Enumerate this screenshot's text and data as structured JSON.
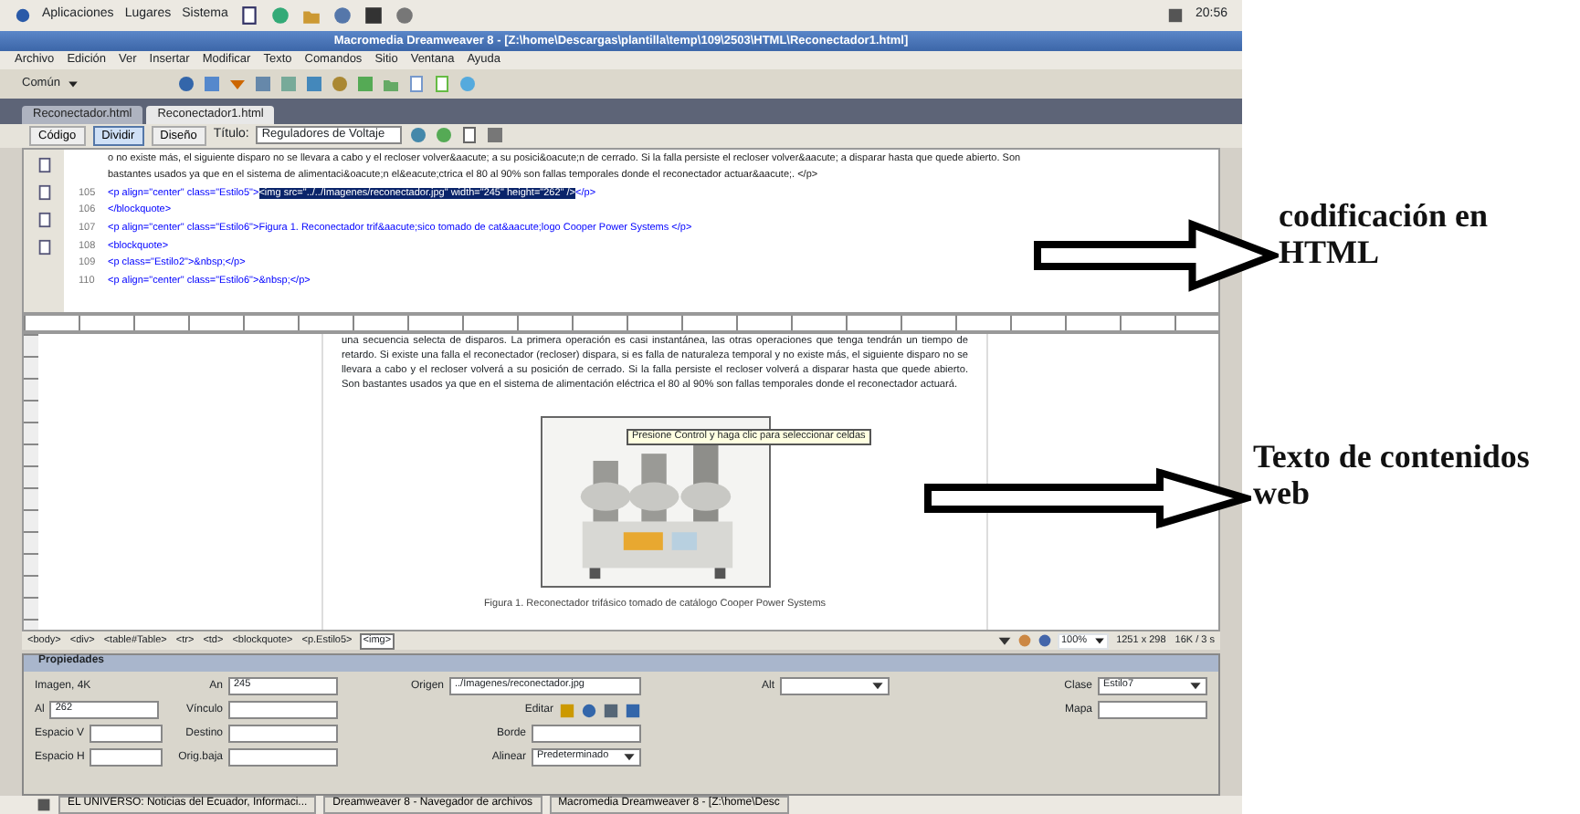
{
  "top_panel": {
    "menus": [
      "Aplicaciones",
      "Lugares",
      "Sistema"
    ],
    "clock": "20:56"
  },
  "window": {
    "title": "Macromedia Dreamweaver 8 - [Z:\\home\\Descargas\\plantilla\\temp\\109\\2503\\HTML\\Reconectador1.html]"
  },
  "menu": [
    "Archivo",
    "Edición",
    "Ver",
    "Insertar",
    "Modificar",
    "Texto",
    "Comandos",
    "Sitio",
    "Ventana",
    "Ayuda"
  ],
  "insert_bar": {
    "category": "Común"
  },
  "doc_tabs": [
    {
      "label": "Reconectador.html",
      "selected": false
    },
    {
      "label": "Reconectador1.html",
      "selected": true
    }
  ],
  "view_buttons": [
    {
      "label": "Código",
      "selected": false
    },
    {
      "label": "Dividir",
      "selected": true
    },
    {
      "label": "Diseño",
      "selected": false
    }
  ],
  "title_field": {
    "label": "Título:",
    "value": "Reguladores de Voltaje"
  },
  "code_lines": [
    {
      "text": "o no existe más, el siguiente disparo no se llevara a cabo y el recloser volver&aacute; a su posici&oacute;n de cerrado. Si la falla persiste el recloser volver&aacute; a disparar hasta que quede abierto. Son"
    },
    {
      "text": "bastantes usados ya que en el sistema de alimentaci&oacute;n el&eacute;ctrica el 80 al 90% son fallas temporales donde el reconectador actuar&aacute;. </p>"
    },
    {
      "number": "105",
      "before": "<p align=\"center\" class=\"Estilo5\">",
      "selected_text": "<img src=\"../../Imagenes/reconectador.jpg\" width=\"245\" height=\"262\" />",
      "after": "</p>"
    },
    {
      "number": "106",
      "text": "</blockquote>"
    },
    {
      "number": "107",
      "text": "<p align=\"center\" class=\"Estilo6\">Figura 1. Reconectador trif&aacute;sico tomado de cat&aacute;logo Cooper Power Systems </p>"
    },
    {
      "number": "108",
      "text": "<blockquote>"
    },
    {
      "number": "109",
      "text": "<p class=\"Estilo2\">&nbsp;</p>"
    },
    {
      "number": "110",
      "text": "<p align=\"center\" class=\"Estilo6\">&nbsp;</p>"
    }
  ],
  "design": {
    "paragraph": "una secuencia selecta de disparos. La primera operación es casi instantánea, las otras operaciones que tenga tendrán un tiempo de retardo. Si existe una falla el reconectador (recloser) dispara, si es falla de naturaleza temporal y no existe más, el siguiente disparo no se llevara a cabo y el recloser volverá a su posición de cerrado. Si la falla persiste el recloser volverá a disparar hasta que quede abierto. Son bastantes usados ya que en el sistema de alimentación eléctrica el 80 al 90% son fallas temporales donde el reconectador actuará.",
    "tooltip": "Presione Control y haga clic para seleccionar celdas",
    "caption": "Figura 1. Reconectador trifásico tomado de catálogo Cooper Power Systems"
  },
  "tag_selector": [
    {
      "label": "<body>",
      "selected": false
    },
    {
      "label": "<div>",
      "selected": false
    },
    {
      "label": "<table#Table>",
      "selected": false
    },
    {
      "label": "<tr>",
      "selected": false
    },
    {
      "label": "<td>",
      "selected": false
    },
    {
      "label": "<blockquote>",
      "selected": false
    },
    {
      "label": "<p.Estilo5>",
      "selected": false
    },
    {
      "label": "<img>",
      "selected": true
    }
  ],
  "status": {
    "zoom": "100%",
    "size": "1251 x 298",
    "download": "16K / 3 s"
  },
  "properties": {
    "title": "Propiedades",
    "type_label": "Imagen, 4K",
    "fields": [
      {
        "label": "An",
        "value": "245",
        "kind": "input"
      },
      {
        "label": "Origen",
        "value": "../Imagenes/reconectador.jpg",
        "kind": "input"
      },
      {
        "label": "Alt",
        "kind": "select"
      },
      {
        "label": "Clase",
        "value": "Estilo7",
        "kind": "select"
      },
      {
        "label": "Al",
        "value": "262",
        "kind": "input"
      },
      {
        "label": "Vínculo",
        "kind": "input"
      },
      {
        "label": "Editar",
        "kind": "tools"
      },
      {
        "label": "Mapa",
        "kind": "input"
      },
      {
        "label": "Espacio V",
        "kind": "input"
      },
      {
        "label": "Destino",
        "kind": "input"
      },
      {
        "label": "Borde",
        "kind": "input"
      },
      {
        "label": "Espacio H",
        "kind": "input"
      },
      {
        "label": "Orig.baja",
        "kind": "input"
      },
      {
        "label": "Alinear",
        "value": "Predeterminado",
        "kind": "select"
      }
    ]
  },
  "taskbar": [
    {
      "label": "EL UNIVERSO: Noticias del Ecuador, Informaci..."
    },
    {
      "label": "Dreamweaver 8 - Navegador de archivos"
    },
    {
      "label": "Macromedia Dreamweaver 8 - [Z:\\home\\Desc"
    }
  ],
  "annotations": [
    {
      "text": "codificación en HTML"
    },
    {
      "text": "Texto de contenidos web"
    }
  ]
}
